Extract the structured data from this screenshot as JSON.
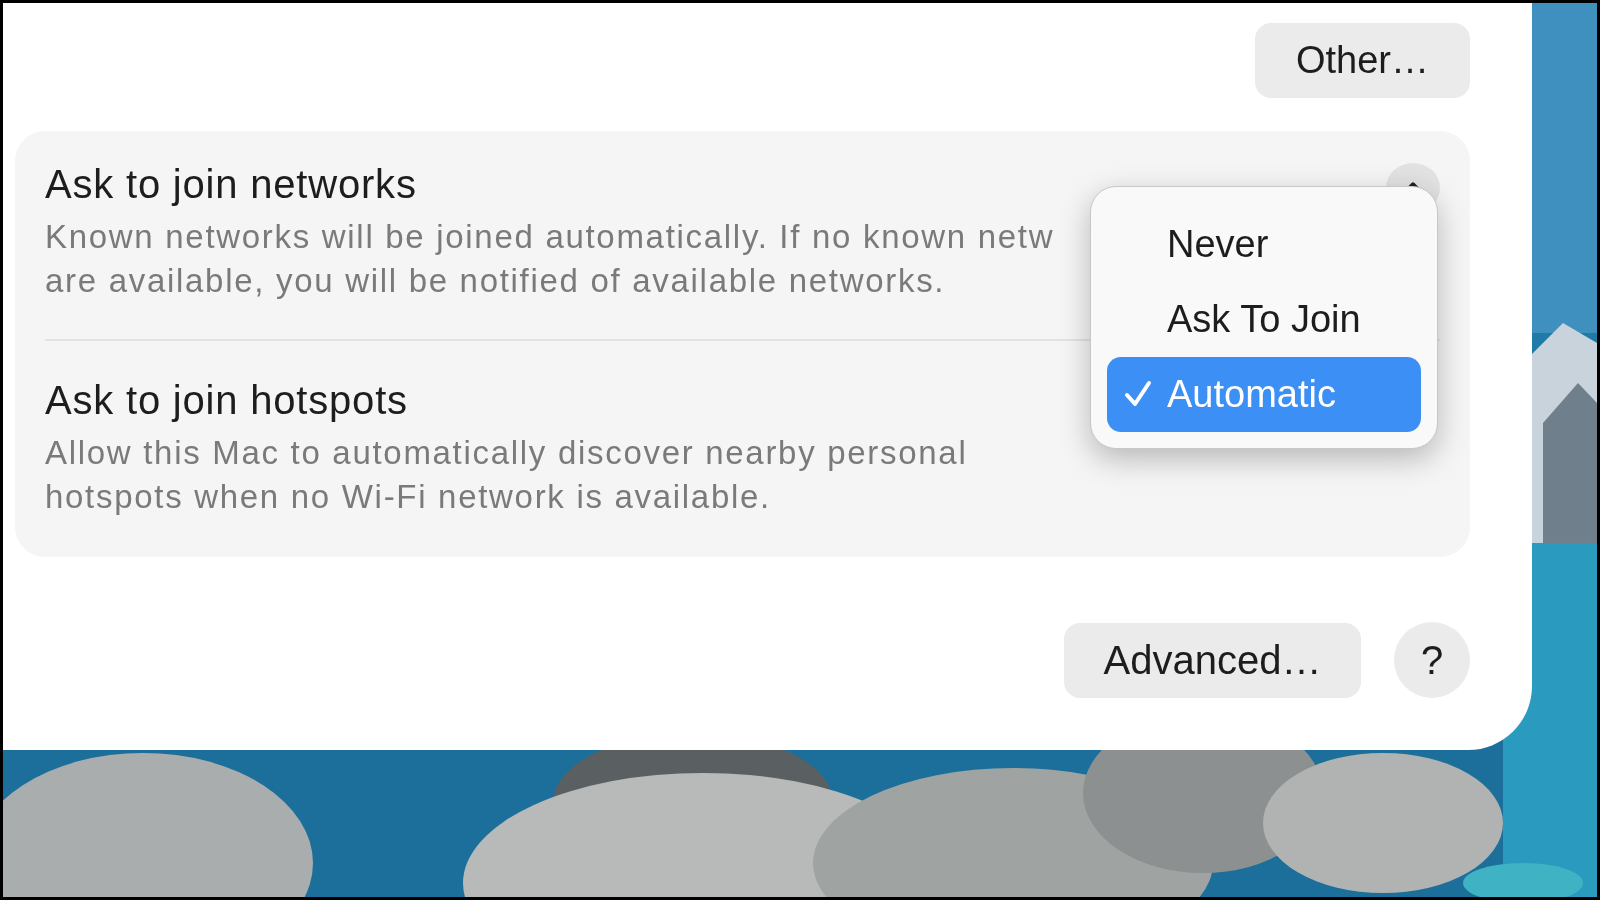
{
  "other_button": {
    "label": "Other…"
  },
  "settings": [
    {
      "title": "Ask to join networks",
      "description_lines": [
        "Known networks will be joined automatically. If no known netw",
        "are available, you will be notified of available networks."
      ],
      "control": {
        "kind": "popup",
        "expanded": true
      }
    },
    {
      "title": "Ask to join hotspots",
      "description_lines": [
        "Allow this Mac to automatically discover nearby personal",
        "hotspots when no Wi-Fi network is available."
      ]
    }
  ],
  "menu": {
    "items": [
      {
        "label": "Never",
        "selected": false
      },
      {
        "label": "Ask To Join",
        "selected": false
      },
      {
        "label": "Automatic",
        "selected": true
      }
    ]
  },
  "footer": {
    "advanced_button": {
      "label": "Advanced…"
    },
    "help_button": {
      "label": "?"
    }
  }
}
